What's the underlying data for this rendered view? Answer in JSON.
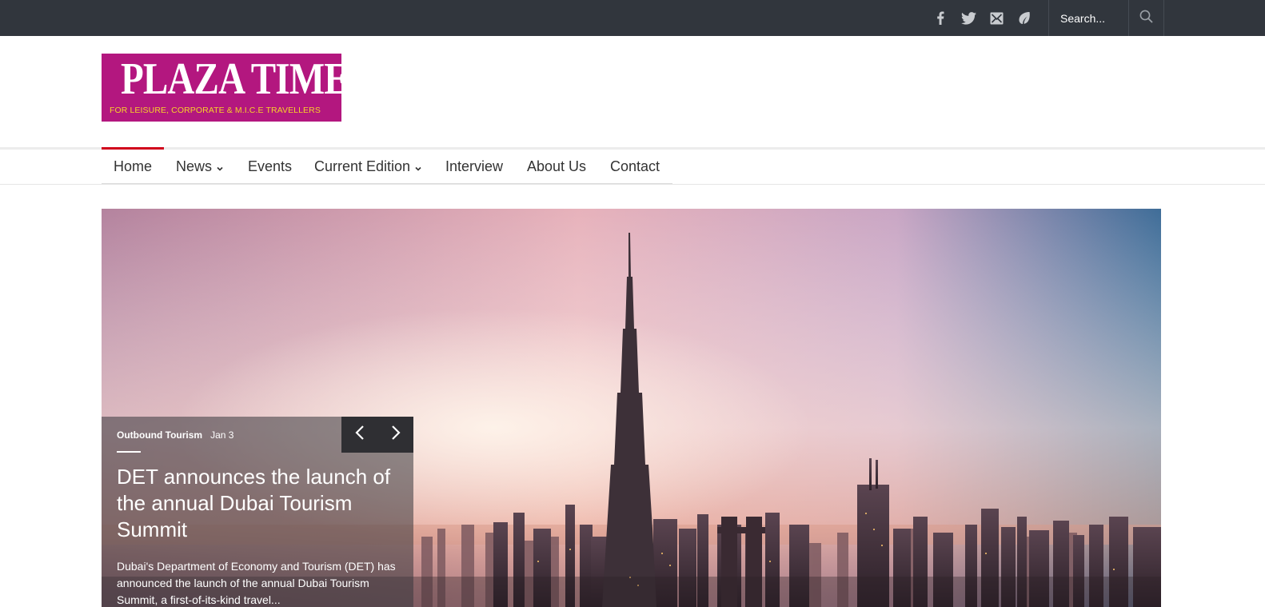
{
  "topbar": {
    "social": [
      {
        "name": "facebook-icon"
      },
      {
        "name": "twitter-icon"
      },
      {
        "name": "email-icon"
      },
      {
        "name": "leaf-icon"
      }
    ],
    "search": {
      "placeholder": "Search..."
    }
  },
  "logo": {
    "title": "PLAZA TIMES",
    "tagline": "FOR LEISURE, CORPORATE & M.I.C.E TRAVELLERS",
    "colors": {
      "background": "#b3177f",
      "title": "#ffffff",
      "tagline": "#f7d229"
    }
  },
  "nav": {
    "items": [
      {
        "label": "Home",
        "active": true
      },
      {
        "label": "News",
        "dropdown": true
      },
      {
        "label": "Events"
      },
      {
        "label": "Current Edition",
        "dropdown": true
      },
      {
        "label": "Interview"
      },
      {
        "label": "About Us"
      },
      {
        "label": "Contact"
      }
    ],
    "accent": "#d0021b"
  },
  "hero": {
    "category": "Outbound Tourism",
    "date": "Jan 3",
    "headline": "DET announces the launch of the annual Dubai Tourism Summit",
    "excerpt": "Dubai's Department of Economy and Tourism (DET) has announced the launch of the annual Dubai Tourism Summit, a first-of-its-kind travel..."
  }
}
